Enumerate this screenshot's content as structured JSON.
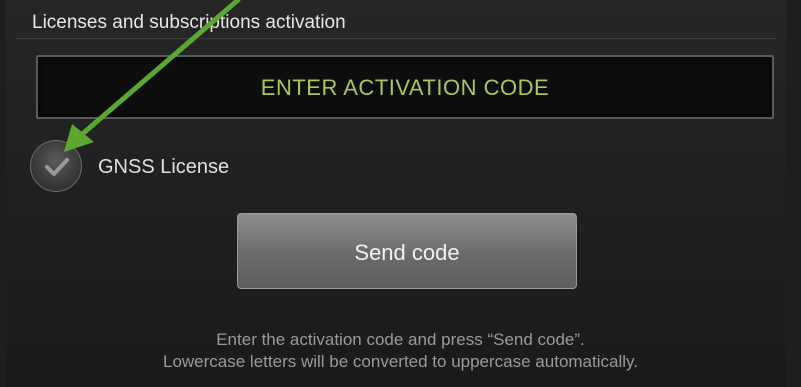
{
  "header": {
    "title": "Licenses and subscriptions activation"
  },
  "activation": {
    "placeholder": "ENTER ACTIVATION CODE",
    "accent_color": "#a8c85a"
  },
  "license_option": {
    "label": "GNSS License",
    "checked": true
  },
  "send_button": {
    "label": "Send code"
  },
  "hint": {
    "line1": "Enter the activation code and press “Send code”.",
    "line2": "Lowercase letters will be converted to uppercase automatically."
  },
  "annotation": {
    "arrow_color": "#5aa830",
    "icon": "arrow-annotation"
  }
}
